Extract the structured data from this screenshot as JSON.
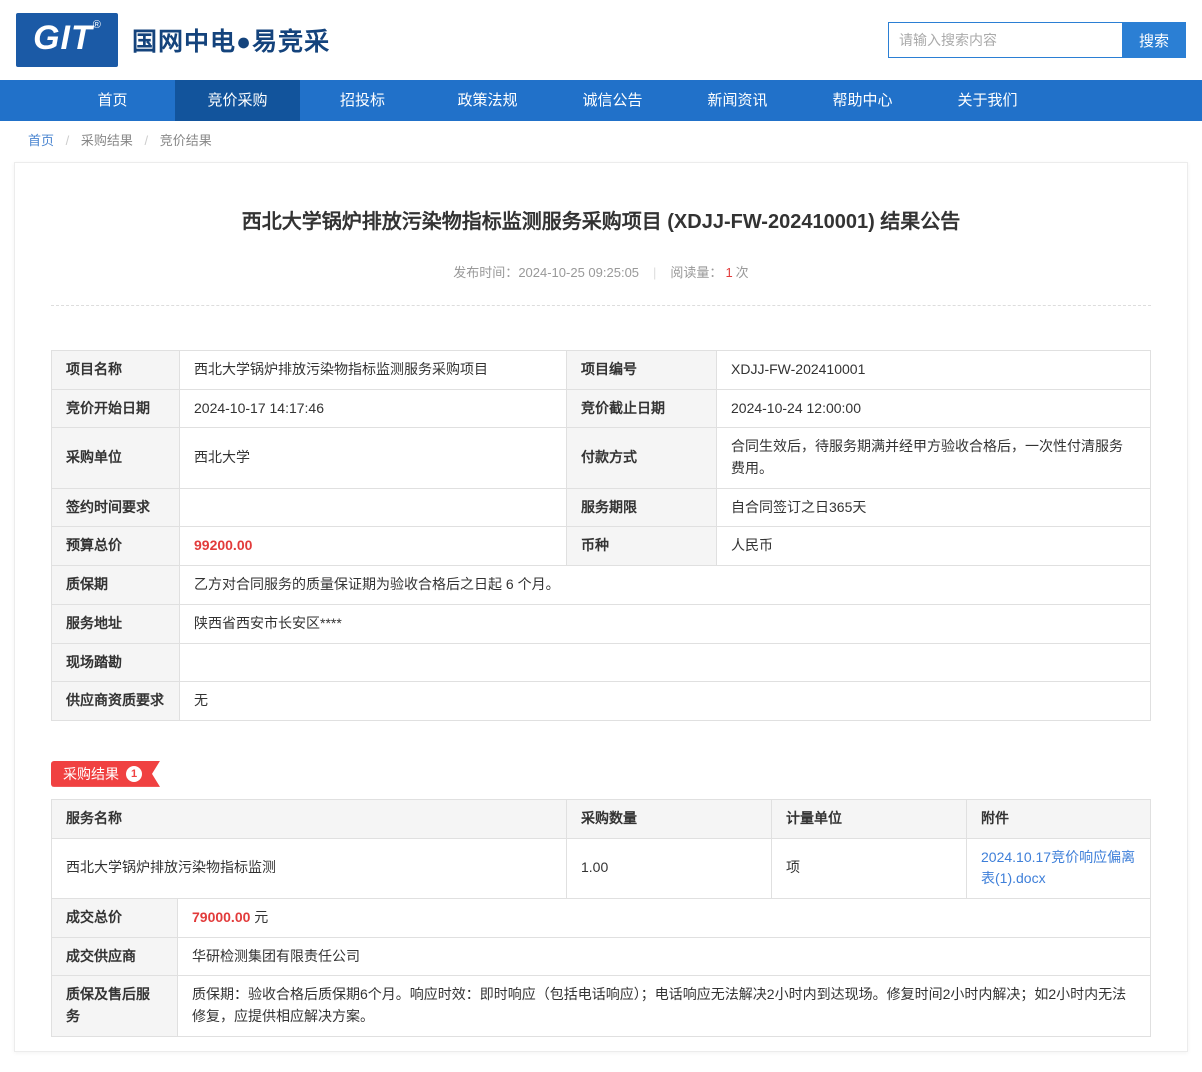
{
  "colors": {
    "nav_blue": "#2171c9",
    "nav_active_blue": "#12549c",
    "logo_blue": "#1b5aa6",
    "accent_red": "#e23b3b",
    "badge_red": "#f04141",
    "link_blue": "#3e7fd9"
  },
  "header": {
    "logo_text": "GIT",
    "logo_reg": "®",
    "site_title": "国网中电●易竞采",
    "search_placeholder": "请输入搜索内容",
    "search_button": "搜索"
  },
  "nav": {
    "items": [
      {
        "label": "首页"
      },
      {
        "label": "竞价采购"
      },
      {
        "label": "招投标"
      },
      {
        "label": "政策法规"
      },
      {
        "label": "诚信公告"
      },
      {
        "label": "新闻资讯"
      },
      {
        "label": "帮助中心"
      },
      {
        "label": "关于我们"
      }
    ]
  },
  "breadcrumb": {
    "separator": "/",
    "items": [
      {
        "label": "首页"
      },
      {
        "label": "采购结果"
      },
      {
        "label": "竞价结果"
      }
    ]
  },
  "article": {
    "title": "西北大学锅炉排放污染物指标监测服务采购项目 (XDJJ-FW-202410001) 结果公告",
    "publish_label": "发布时间：",
    "publish_time": "2024-10-25 09:25:05",
    "meta_separator": "|",
    "views_label": "阅读量：",
    "views_count": "1",
    "views_unit": "次"
  },
  "project_table": {
    "rows4": [
      {
        "l1": "项目名称",
        "v1": "西北大学锅炉排放污染物指标监测服务采购项目",
        "l2": "项目编号",
        "v2": "XDJJ-FW-202410001"
      },
      {
        "l1": "竞价开始日期",
        "v1": "2024-10-17 14:17:46",
        "l2": "竞价截止日期",
        "v2": "2024-10-24 12:00:00"
      },
      {
        "l1": "采购单位",
        "v1": "西北大学",
        "l2": "付款方式",
        "v2": "合同生效后，待服务期满并经甲方验收合格后，一次性付清服务费用。"
      },
      {
        "l1": "签约时间要求",
        "v1": "",
        "l2": "服务期限",
        "v2": "自合同签订之日365天"
      },
      {
        "l1": "预算总价",
        "v1": "99200.00",
        "l2": "币种",
        "v2": "人民币"
      }
    ],
    "rows_full": [
      {
        "label": "质保期",
        "value": "乙方对合同服务的质量保证期为验收合格后之日起 6 个月。"
      },
      {
        "label": "服务地址",
        "value": "陕西省西安市长安区****"
      },
      {
        "label": "现场踏勘",
        "value": ""
      },
      {
        "label": "供应商资质要求",
        "value": "无"
      }
    ]
  },
  "result_section": {
    "badge_label": "采购结果",
    "badge_count": "1",
    "table": {
      "headers": [
        "服务名称",
        "采购数量",
        "计量单位",
        "附件"
      ],
      "row": {
        "name": "西北大学锅炉排放污染物指标监测",
        "qty": "1.00",
        "unit": "项",
        "attachment": "2024.10.17竞价响应偏离表(1).docx"
      }
    },
    "footer": {
      "price_label": "成交总价",
      "price_value": "79000.00",
      "price_unit": " 元",
      "supplier_label": "成交供应商",
      "supplier_value": "华研检测集团有限责任公司",
      "service_label": "质保及售后服务",
      "service_value": "质保期：验收合格后质保期6个月。响应时效：即时响应（包括电话响应）；电话响应无法解决2小时内到达现场。修复时间2小时内解决；如2小时内无法修复，应提供相应解决方案。"
    }
  }
}
